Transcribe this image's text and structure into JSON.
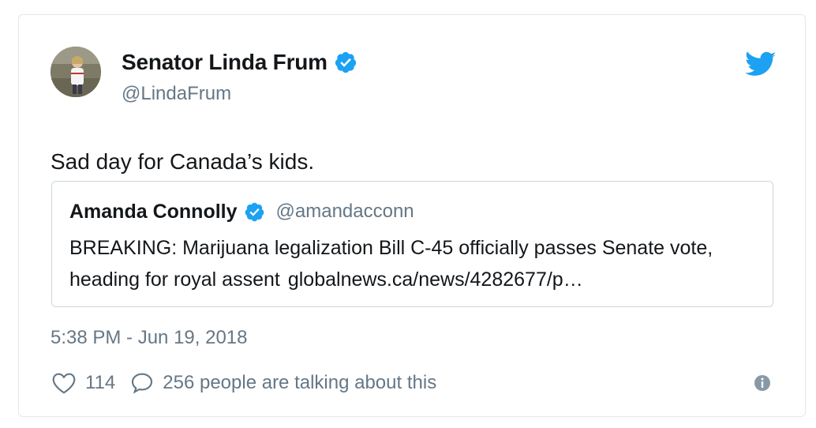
{
  "tweet": {
    "author": {
      "display_name": "Senator Linda Frum",
      "handle": "@LindaFrum",
      "verified": true
    },
    "text": "Sad day for Canada’s kids.",
    "quoted": {
      "display_name": "Amanda Connolly",
      "handle": "@amandacconn",
      "verified": true,
      "text": "BREAKING: Marijuana legalization Bill C-45 officially passes Senate vote, heading for royal assent",
      "link": "globalnews.ca/news/4282677/p…"
    },
    "timestamp": "5:38 PM - Jun 19, 2018",
    "likes": "114",
    "talking": "256 people are talking about this"
  },
  "icons": {
    "brand": "twitter-bird-icon",
    "verified": "verified-badge-icon",
    "like": "heart-icon",
    "reply": "speech-bubble-icon",
    "info": "info-icon"
  },
  "colors": {
    "twitter_blue": "#1da1f2",
    "secondary_text": "#657786",
    "border": "#e1e8ed"
  }
}
